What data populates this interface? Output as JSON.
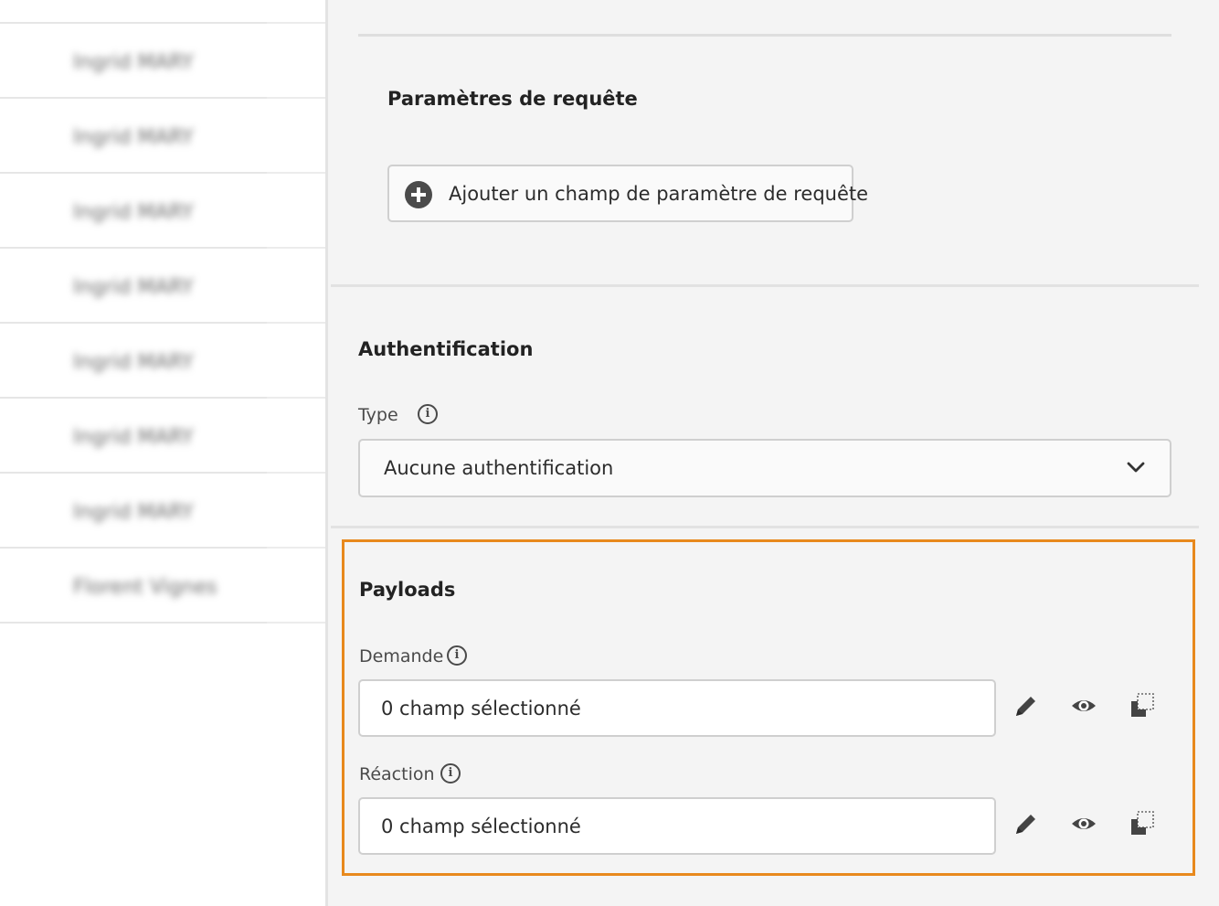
{
  "left_list": {
    "items": [
      {
        "name": "Ingrid MARY"
      },
      {
        "name": "Ingrid MARY"
      },
      {
        "name": "Ingrid MARY"
      },
      {
        "name": "Ingrid MARY"
      },
      {
        "name": "Ingrid MARY"
      },
      {
        "name": "Ingrid MARY"
      },
      {
        "name": "Ingrid MARY"
      },
      {
        "name": "Florent Vignes"
      }
    ]
  },
  "query_params": {
    "title": "Paramètres de requête",
    "add_button_label": "Ajouter un champ de paramètre de requête",
    "add_icon": "add-circle-icon"
  },
  "authentication": {
    "title": "Authentification",
    "type_label": "Type",
    "type_value": "Aucune authentification",
    "dropdown_icon": "chevron-down-icon"
  },
  "payloads": {
    "title": "Payloads",
    "highlight_color": "#e8891d",
    "request": {
      "label": "Demande",
      "value": "0 champ sélectionné"
    },
    "response": {
      "label": "Réaction",
      "value": "0 champ sélectionné"
    },
    "actions": [
      "edit-pencil-icon",
      "preview-eye-icon",
      "copy-icon"
    ]
  }
}
